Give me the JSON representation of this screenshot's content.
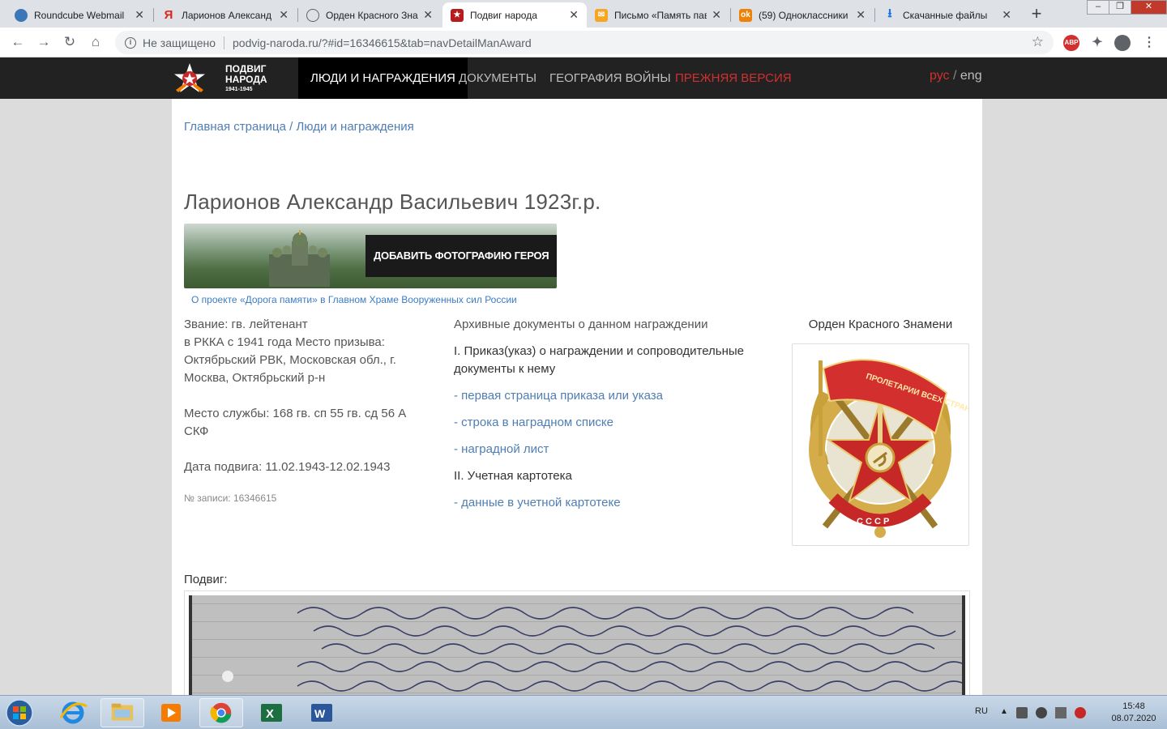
{
  "browser": {
    "tabs": [
      {
        "label": "Roundcube Webmail",
        "icon": "roundcube-icon"
      },
      {
        "label": "Ларионов Александ",
        "icon": "yandex-icon"
      },
      {
        "label": "Орден Красного Зна",
        "icon": "globe-icon"
      },
      {
        "label": "Подвиг народа",
        "icon": "podvig-icon",
        "active": true
      },
      {
        "label": "Письмо «Память пав",
        "icon": "mail-icon"
      },
      {
        "label": "(59) Одноклассники",
        "icon": "ok-icon"
      },
      {
        "label": "Скачанные файлы",
        "icon": "download-icon"
      }
    ],
    "new_tab": "+",
    "omnibox": {
      "security": "Не защищено",
      "url": "podvig-naroda.ru/?#id=16346615&tab=navDetailManAward"
    },
    "extensions": {
      "abp": "ABP"
    }
  },
  "site": {
    "logo": {
      "line1": "ПОДВИГ",
      "line2": "НАРОДА",
      "years": "1941-1945"
    },
    "nav": [
      {
        "label": "ЛЮДИ И НАГРАЖДЕНИЯ",
        "active": true
      },
      {
        "label": "ДОКУМЕНТЫ"
      },
      {
        "label": "ГЕОГРАФИЯ ВОЙНЫ"
      },
      {
        "label": "ПРЕЖНЯЯ ВЕРСИЯ",
        "highlight": "#d32f2f"
      }
    ],
    "lang": {
      "ru": "рус",
      "sep": "/",
      "en": "eng"
    }
  },
  "breadcrumb": {
    "home": "Главная страница",
    "sep": " / ",
    "current": "Люди и награждения"
  },
  "person": {
    "title": "Ларионов Александр Васильевич 1923г.р.",
    "rank": "Звание: гв. лейтенант",
    "draft": "в РККА с 1941 года Место призыва: Октябрьский РВК, Московская обл., г. Москва, Октябрьский р-н",
    "service": "Место службы: 168 гв. сп 55 гв. сд 56 А СКФ",
    "feat_date": "Дата подвига: 11.02.1943-12.02.1943",
    "record": "№ записи: 16346615"
  },
  "banner": {
    "button": "ДОБАВИТЬ ФОТОГРАФИЮ ГЕРОЯ",
    "link": "О проекте «Дорога памяти» в Главном Храме Вооруженных сил России"
  },
  "archive": {
    "heading": "Архивные документы о данном награждении",
    "section1": "I. Приказ(указ) о награждении и сопроводительные документы к нему",
    "links1": [
      "- первая страница приказа или указа",
      "- строка в наградном списке",
      "- наградной лист"
    ],
    "section2": "II. Учетная картотека",
    "links2": [
      "- данные в учетной картотеке"
    ]
  },
  "award": {
    "title": "Орден Красного Знамени",
    "banner_text": "ПРОЛЕТАРИИ ВСЕХ СТРАН, СОЕДИНЯЙТЕСЬ!",
    "ring_text": "С С С Р"
  },
  "feat": {
    "label": "Подвиг:"
  },
  "taskbar": {
    "lang": "RU",
    "time": "15:48",
    "date": "08.07.2020"
  },
  "colors": {
    "accent_red": "#d32f2f",
    "link_blue": "#4f7eb3",
    "header_bg": "#222222"
  }
}
